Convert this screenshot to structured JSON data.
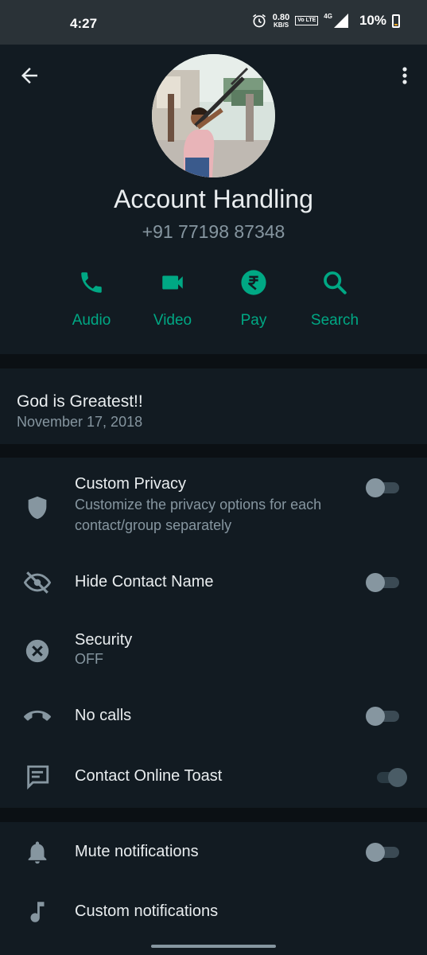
{
  "status_bar": {
    "time": "4:27",
    "net_speed_value": "0.80",
    "net_speed_unit": "KB/S",
    "volte": "Vo LTE",
    "network": "4G",
    "battery": "10%"
  },
  "contact": {
    "name": "Account Handling",
    "phone": "+91 77198 87348"
  },
  "actions": [
    {
      "label": "Audio",
      "icon": "phone-icon"
    },
    {
      "label": "Video",
      "icon": "video-icon"
    },
    {
      "label": "Pay",
      "icon": "rupee-icon"
    },
    {
      "label": "Search",
      "icon": "search-icon"
    }
  ],
  "about": {
    "text": "God is Greatest!!",
    "date": "November 17, 2018"
  },
  "settings": [
    {
      "title": "Custom Privacy",
      "subtitle": "Customize the privacy options for each contact/group separately",
      "icon": "shield-icon",
      "toggle": false
    },
    {
      "title": "Hide Contact Name",
      "icon": "eye-off-icon",
      "toggle": false
    },
    {
      "title": "Security",
      "subtitle": "OFF",
      "icon": "close-circle-icon"
    },
    {
      "title": "No calls",
      "icon": "call-end-icon",
      "toggle": false
    },
    {
      "title": "Contact Online Toast",
      "icon": "message-icon",
      "toggle": true
    }
  ],
  "notifications": [
    {
      "title": "Mute notifications",
      "icon": "bell-icon",
      "toggle": false
    },
    {
      "title": "Custom notifications",
      "icon": "music-note-icon"
    }
  ],
  "colors": {
    "accent": "#00a884",
    "background": "#0b1014",
    "surface": "#121b22",
    "status_bar": "#2a3237"
  }
}
